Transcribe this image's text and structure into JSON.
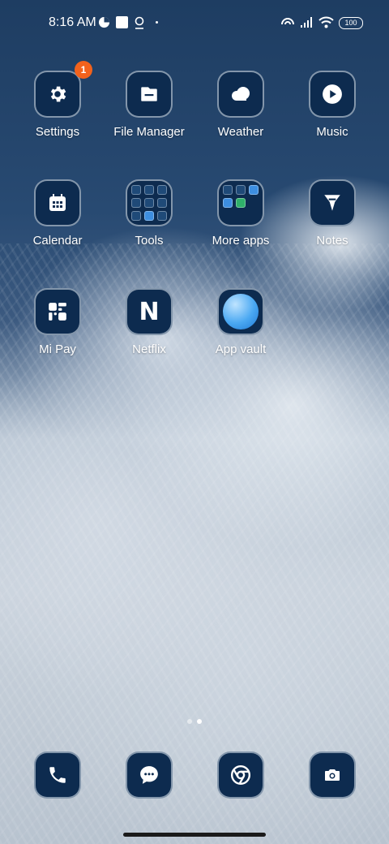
{
  "status_bar": {
    "time": "8:16 AM",
    "battery": "100",
    "left_icons": [
      "pie-icon",
      "square-icon",
      "location-icon",
      "dot-icon"
    ],
    "right_icons": [
      "hotspot-icon",
      "signal-icon",
      "wifi-icon",
      "battery-icon"
    ]
  },
  "apps": [
    {
      "label": "Settings",
      "icon": "gear-icon",
      "badge": "1"
    },
    {
      "label": "File Manager",
      "icon": "folder-icon"
    },
    {
      "label": "Weather",
      "icon": "cloud-icon"
    },
    {
      "label": "Music",
      "icon": "play-icon"
    },
    {
      "label": "Calendar",
      "icon": "calendar-icon"
    },
    {
      "label": "Tools",
      "icon": "folder-grid-icon"
    },
    {
      "label": "More apps",
      "icon": "folder-grid-icon"
    },
    {
      "label": "Notes",
      "icon": "notes-icon"
    },
    {
      "label": "Mi Pay",
      "icon": "mipay-icon"
    },
    {
      "label": "Netflix",
      "icon": "netflix-icon"
    },
    {
      "label": "App vault",
      "icon": "app-vault-icon"
    }
  ],
  "dock": [
    {
      "icon": "phone-icon"
    },
    {
      "icon": "messages-icon"
    },
    {
      "icon": "chrome-icon"
    },
    {
      "icon": "camera-icon"
    }
  ],
  "page_indicator": {
    "pages": 2,
    "active": 2
  },
  "colors": {
    "tile": "#0d2b4f",
    "badge": "#f2621c",
    "sky": "#1e3d62"
  }
}
